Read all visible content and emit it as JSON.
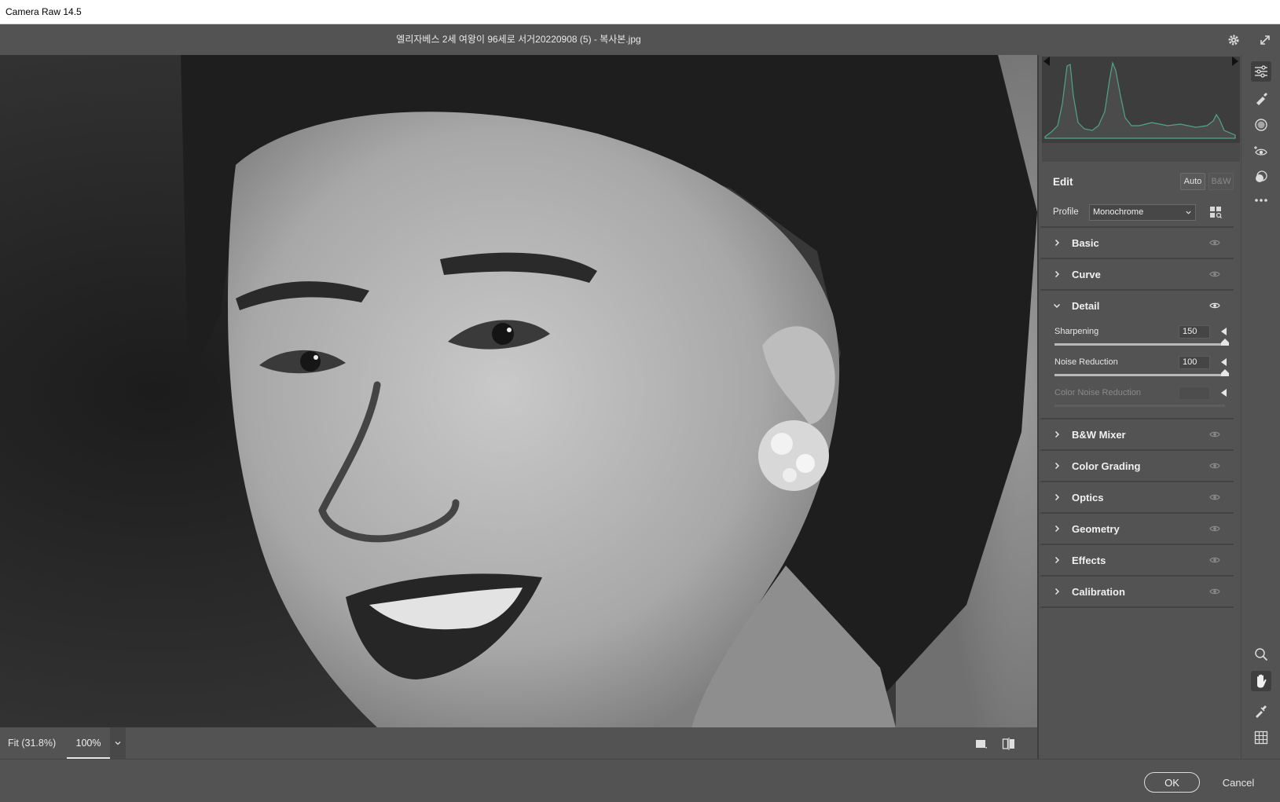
{
  "window": {
    "title": "Camera Raw 14.5"
  },
  "file": {
    "name": "엘리자베스 2세 여왕이 96세로 서거20220908 (5) - 복사본.jpg"
  },
  "image_bar": {
    "fit_label": "Fit (31.8%)",
    "zoom_value": "100%"
  },
  "edit": {
    "title": "Edit",
    "auto_label": "Auto",
    "bw_label": "B&W",
    "profile_label": "Profile",
    "profile_value": "Monochrome"
  },
  "sections": {
    "basic": "Basic",
    "curve": "Curve",
    "detail": "Detail",
    "bw_mixer": "B&W Mixer",
    "color_grading": "Color Grading",
    "optics": "Optics",
    "geometry": "Geometry",
    "effects": "Effects",
    "calibration": "Calibration"
  },
  "detail": {
    "sharpening": {
      "label": "Sharpening",
      "value": "150",
      "fraction": 1.0
    },
    "noise_reduction": {
      "label": "Noise Reduction",
      "value": "100",
      "fraction": 1.0
    },
    "color_noise_reduction": {
      "label": "Color Noise Reduction",
      "value": "",
      "fraction": 0.0
    }
  },
  "actions": {
    "ok_label": "OK",
    "cancel_label": "Cancel"
  },
  "colors": {
    "panel_bg": "#535353",
    "histogram_line": "#4fa58a"
  },
  "icons": {
    "header": [
      "gear-icon",
      "expand-icon"
    ],
    "toolbar": [
      "edit-sliders-icon",
      "healing-brush-icon",
      "mask-icon",
      "red-eye-icon",
      "presets-icon",
      "more-icon",
      "zoom-icon",
      "hand-icon",
      "white-balance-icon",
      "grid-icon"
    ],
    "view": [
      "single-view-icon",
      "before-after-icon"
    ]
  }
}
